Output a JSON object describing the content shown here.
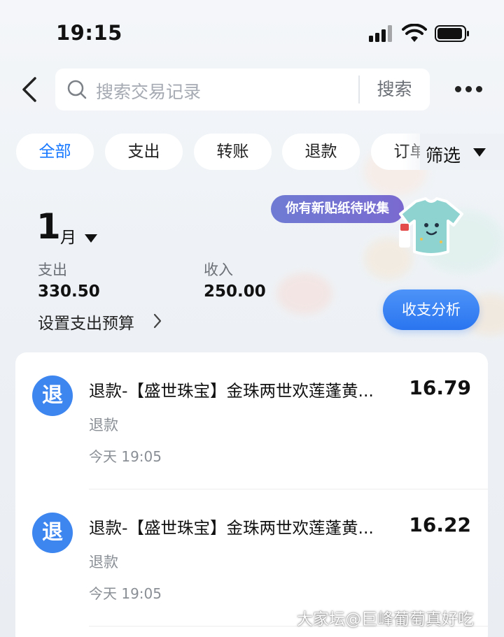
{
  "status_bar": {
    "time": "19:15"
  },
  "search": {
    "placeholder": "搜索交易记录",
    "button_label": "搜索"
  },
  "filters": {
    "chips": [
      {
        "label": "全部",
        "active": true
      },
      {
        "label": "支出",
        "active": false
      },
      {
        "label": "转账",
        "active": false
      },
      {
        "label": "退款",
        "active": false
      },
      {
        "label": "订单",
        "active": false
      }
    ],
    "filter_label": "筛选"
  },
  "summary": {
    "month_number": "1",
    "month_unit": "月",
    "expense_label": "支出",
    "expense_value": "330.50",
    "income_label": "收入",
    "income_value": "250.00",
    "budget_label": "设置支出预算",
    "sticker_text": "你有新贴纸待收集",
    "analysis_button": "收支分析"
  },
  "transactions": [
    {
      "icon_text": "退",
      "title": "退款-【盛世珠宝】金珠两世欢莲蓬黄...",
      "type": "退款",
      "time": "今天 19:05",
      "amount": "16.79"
    },
    {
      "icon_text": "退",
      "title": "退款-【盛世珠宝】金珠两世欢莲蓬黄...",
      "type": "退款",
      "time": "今天 19:05",
      "amount": "16.22"
    }
  ],
  "watermark": "大家坛@巨峰葡萄真好吃",
  "colors": {
    "accent": "#1677ff",
    "refund_icon_bg": "#3d86f0",
    "analysis_button": "#3a82f4",
    "sticker_bubble": "#7276d2"
  }
}
